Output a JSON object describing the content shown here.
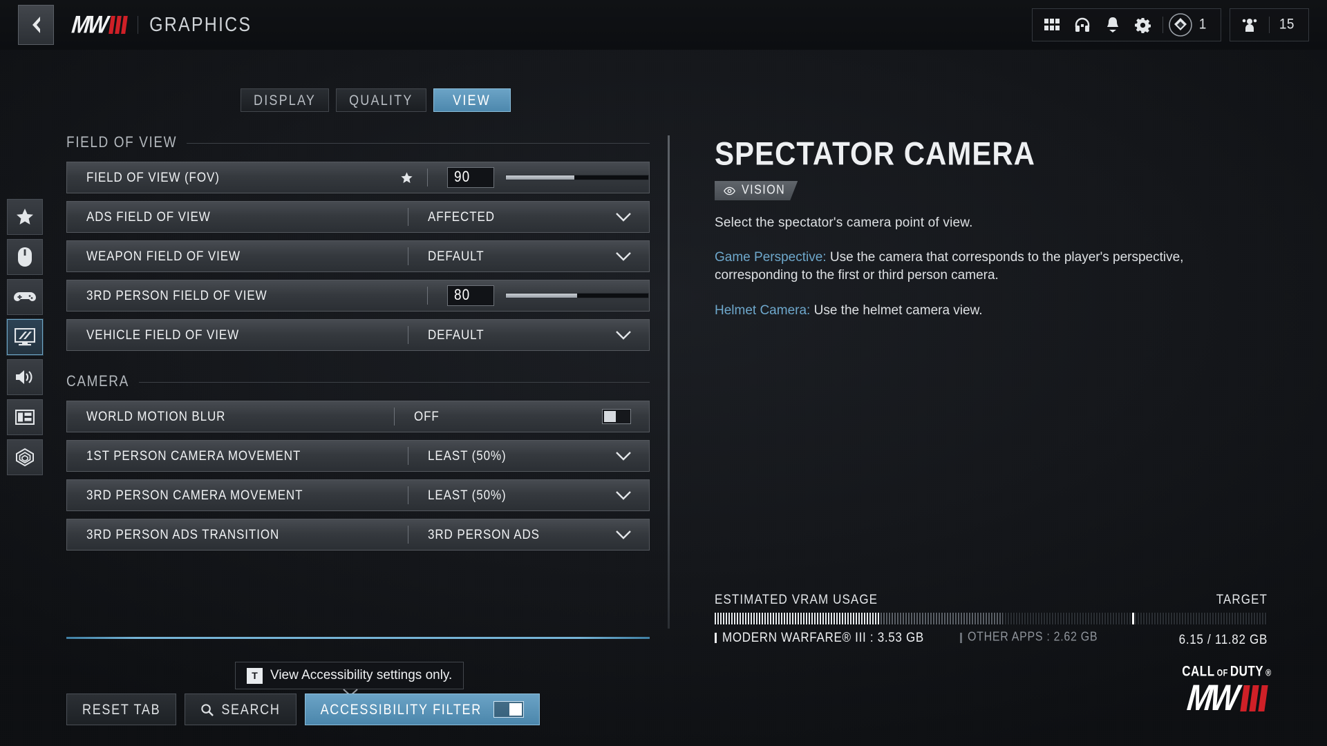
{
  "header": {
    "back_icon": "chevron-left-icon",
    "logo_text": "MW",
    "page_title": "GRAPHICS",
    "icons": [
      {
        "name": "apps-grid-icon"
      },
      {
        "name": "headset-icon"
      },
      {
        "name": "notification-bell-icon"
      },
      {
        "name": "gear-icon"
      }
    ],
    "rank_icon": "rank-badge-icon",
    "rank_value": "1",
    "squad_icon": "squad-player-icon",
    "squad_value": "15"
  },
  "sidebar": {
    "items": [
      {
        "name": "sidebar-item-favorites",
        "icon": "star-icon",
        "active": false
      },
      {
        "name": "sidebar-item-mouse-keyboard",
        "icon": "mouse-icon",
        "active": false
      },
      {
        "name": "sidebar-item-controller",
        "icon": "gamepad-icon",
        "active": false
      },
      {
        "name": "sidebar-item-graphics",
        "icon": "monitor-graphics-icon",
        "active": true
      },
      {
        "name": "sidebar-item-audio",
        "icon": "speaker-icon",
        "active": false
      },
      {
        "name": "sidebar-item-interface",
        "icon": "interface-layout-icon",
        "active": false
      },
      {
        "name": "sidebar-item-telemetry",
        "icon": "radar-telemetry-icon",
        "active": false
      }
    ]
  },
  "tabs": [
    {
      "label": "DISPLAY",
      "active": false
    },
    {
      "label": "QUALITY",
      "active": false
    },
    {
      "label": "VIEW",
      "active": true
    }
  ],
  "sections": [
    {
      "title": "FIELD OF VIEW",
      "rows": [
        {
          "label": "FIELD OF VIEW (FOV)",
          "type": "slider",
          "value": "90",
          "fill_pct": 48,
          "favorited": true
        },
        {
          "label": "ADS FIELD OF VIEW",
          "type": "dropdown",
          "value": "AFFECTED"
        },
        {
          "label": "WEAPON FIELD OF VIEW",
          "type": "dropdown",
          "value": "DEFAULT"
        },
        {
          "label": "3RD PERSON FIELD OF VIEW",
          "type": "slider",
          "value": "80",
          "fill_pct": 50,
          "favorited": false
        },
        {
          "label": "VEHICLE FIELD OF VIEW",
          "type": "dropdown",
          "value": "DEFAULT"
        }
      ]
    },
    {
      "title": "CAMERA",
      "rows": [
        {
          "label": "WORLD MOTION BLUR",
          "type": "toggle",
          "value": "OFF",
          "toggle_on": false
        },
        {
          "label": "1ST PERSON CAMERA MOVEMENT",
          "type": "dropdown",
          "value": "LEAST (50%)"
        },
        {
          "label": "3RD PERSON CAMERA MOVEMENT",
          "type": "dropdown",
          "value": "LEAST (50%)"
        },
        {
          "label": "3RD PERSON ADS TRANSITION",
          "type": "dropdown",
          "value": "3RD PERSON ADS"
        }
      ]
    }
  ],
  "detail": {
    "title": "SPECTATOR CAMERA",
    "tag_icon": "eye-vision-icon",
    "tag_label": "VISION",
    "description": "Select the spectator's camera point of view.",
    "entries": [
      {
        "key": "Game Perspective:",
        "text": " Use the camera that corresponds to the player's perspective, corresponding to the first or third person camera."
      },
      {
        "key": "Helmet Camera:",
        "text": " Use the helmet camera view."
      }
    ]
  },
  "vram": {
    "label": "ESTIMATED VRAM USAGE",
    "target_label": "TARGET",
    "primary_legend": "MODERN WARFARE® III : 3.53 GB",
    "secondary_legend": "OTHER APPS : 2.62 GB",
    "total": "6.15 / 11.82 GB",
    "used_pct": 29.9,
    "other_pct": 22.2,
    "target_pct": 75.5
  },
  "bottom": {
    "reset_label": "RESET TAB",
    "search_icon": "search-icon",
    "search_label": "SEARCH",
    "filter_label": "ACCESSIBILITY FILTER",
    "filter_on": true,
    "tooltip_key": "T",
    "tooltip_text": "View Accessibility settings only."
  },
  "branding": {
    "cod_call": "CALL",
    "cod_of": "OF",
    "cod_duty": "DUTY",
    "cod_reg": "®",
    "mw_text": "MW"
  },
  "colors": {
    "accent": "#6ba3c6",
    "red": "#cf2027",
    "text": "#eef0f2"
  }
}
